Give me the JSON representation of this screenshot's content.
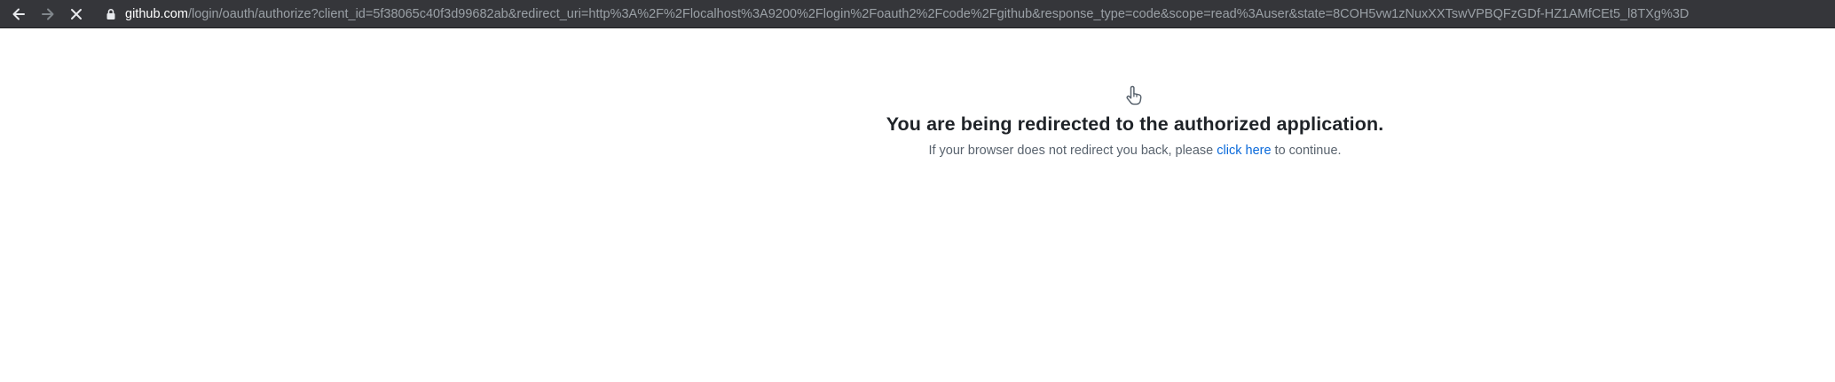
{
  "browser": {
    "nav": {
      "back_icon": "arrow-left-icon",
      "forward_icon": "arrow-right-icon",
      "stop_icon": "close-icon"
    },
    "address_bar": {
      "lock_icon": "lock-icon",
      "host": "github.com",
      "path": "/login/oauth/authorize?client_id=5f38065c40f3d99682ab&redirect_uri=http%3A%2F%2Flocalhost%3A9200%2Flogin%2Foauth2%2Fcode%2Fgithub&response_type=code&scope=read%3Auser&state=8COH5vw1zNuxXXTswVPBQFzGDf-HZ1AMfCEt5_l8TXg%3D"
    }
  },
  "page": {
    "icon": "pointing-hand-icon",
    "title": "You are being redirected to the authorized application.",
    "message_prefix": "If your browser does not redirect you back, please ",
    "link_label": "click here",
    "message_suffix": " to continue."
  },
  "colors": {
    "toolbar_bg": "#35363a",
    "link": "#0969da",
    "title": "#1f2328",
    "muted": "#59636e"
  }
}
